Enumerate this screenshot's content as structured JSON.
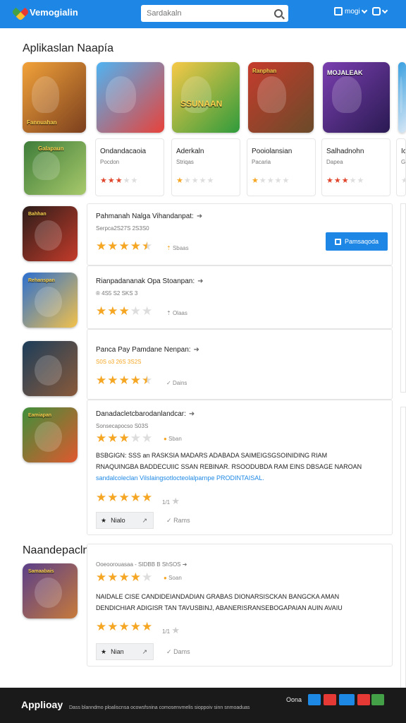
{
  "header": {
    "brand": "Vemogialin",
    "search_placeholder": "Sardakaln",
    "menu1_label": "mogi",
    "icons": [
      "app-logo-icon",
      "search-icon",
      "store-icon",
      "account-icon",
      "chevron-down-icon"
    ]
  },
  "featured": {
    "title": "Aplikaslan Naapía",
    "tiles": [
      {
        "label": "Fannuahan",
        "colors": [
          "#f2a23a",
          "#7b3f1d"
        ]
      },
      {
        "label": "",
        "colors": [
          "#4fb3f2",
          "#e8423a"
        ]
      },
      {
        "label": "SSUNAAN",
        "colors": [
          "#f7c948",
          "#2f9b3c"
        ]
      },
      {
        "label": "Ranphan",
        "colors": [
          "#c63b2c",
          "#6a4b2a"
        ]
      },
      {
        "label": "MOJALEAK",
        "colors": [
          "#7a3fb0",
          "#2a1a52"
        ]
      },
      {
        "label": "",
        "colors": [
          "#3aa0e0",
          "#d7e7f5"
        ]
      }
    ],
    "mini_art": {
      "label": "Galapaun",
      "colors": [
        "#3e7d3a",
        "#a8c96b"
      ]
    },
    "mini": [
      {
        "title": "Ondandacaoia",
        "sub": "Pocdon",
        "rating": 3,
        "star_color": "#e0452b"
      },
      {
        "title": "Aderkaln",
        "sub": "Striqas",
        "rating": 1,
        "star_color": "#f5a623"
      },
      {
        "title": "Pooiolansian",
        "sub": "Pacaria",
        "rating": 1,
        "star_color": "#f5a623"
      },
      {
        "title": "Salhadnohn",
        "sub": "Dapea",
        "rating": 3,
        "star_color": "#e0452b"
      },
      {
        "title": "Ic",
        "sub": "G",
        "rating": 0,
        "star_color": "#f5a623"
      }
    ]
  },
  "list": [
    {
      "title": "Pahmanah Nalga Vihandanpat:",
      "sub": "Serpca2S27S 2S3S0",
      "rating": 4.5,
      "meta": "Sbaas",
      "install_label": "Pamsaqoda",
      "thumb_label": "Bahhan",
      "thumb_colors": [
        "#2b1d1a",
        "#c43b2a"
      ]
    },
    {
      "title": "Rianpadananak Opa Stoanpan:",
      "sub": "® 4S5 S2 SKS 3",
      "rating": 3,
      "meta": "Olaas",
      "thumb_label": "Rehanspan",
      "thumb_colors": [
        "#2b6fd0",
        "#f2c14b"
      ]
    },
    {
      "title": "Panca Pay Pamdane Nenpan:",
      "sub": "S0S o3 26S 3S2S",
      "rating": 4.5,
      "meta": "Dains",
      "thumb_label": "",
      "thumb_colors": [
        "#1c3d5a",
        "#8a5a3a"
      ]
    },
    {
      "title": "Danadacletcbarodanlandcar:",
      "sub": "Sonsecapocso S03S",
      "rating": 3,
      "meta": "Sban",
      "desc_lines": [
        "BSBGIGN: SSS an RASKSIA MADARS ADABADA SAIMEIGSGSOINIDING RIAM",
        "RNAQUINGBA BADDECUIIC SSAN REBINAR. RSOODUBDA RAM EINS DBSAGE NAROAN"
      ],
      "desc_link": "sandalcoleclan Vilslaingsotlocteolalparnpe PRODINTAISAL.",
      "rating2": 5,
      "rating2_meta": "1/1",
      "action_label": "Nialo",
      "link_label": "Rams",
      "thumb_label": "Eamiapan",
      "thumb_colors": [
        "#3f8f3a",
        "#e0582f"
      ]
    }
  ],
  "section2": {
    "title": "Naandepaclnoiai",
    "item": {
      "sub": "Ooeoorouasaa - SIDBB B ShSOS",
      "rating": 4,
      "meta": "Soan",
      "desc_lines": [
        "NAIDALE CISE CANDIDEIANDADIAN GRABAS DIONARSISCKAN BANGCKA AMAN",
        "DENDICHIAR ADIGISR TAN TAVUSBINJ, ABANERISRANSEBOGAPAIAN AUIN AVAIU"
      ],
      "rating2": 5,
      "rating2_meta": "1/1",
      "action_label": "Nian",
      "link_label": "Dams",
      "thumb_label": "Samaabais",
      "thumb_colors": [
        "#5a3f8a",
        "#c77a3a"
      ]
    }
  },
  "footer": {
    "brand": "Applioay",
    "note": "Dass blanndmo ploaliscnsa ocowsfsnina comosenvmelis sioppoiv sinn snmoaduas",
    "label": "Oona",
    "social_colors": [
      "#1e88e5",
      "#e53935",
      "#1e88e5",
      "#e53935",
      "#43a047"
    ]
  },
  "colors": {
    "accent": "#1e87e5",
    "star": "#f5a623",
    "star_red": "#e0452b",
    "footer_bg": "#1a1a1a"
  }
}
